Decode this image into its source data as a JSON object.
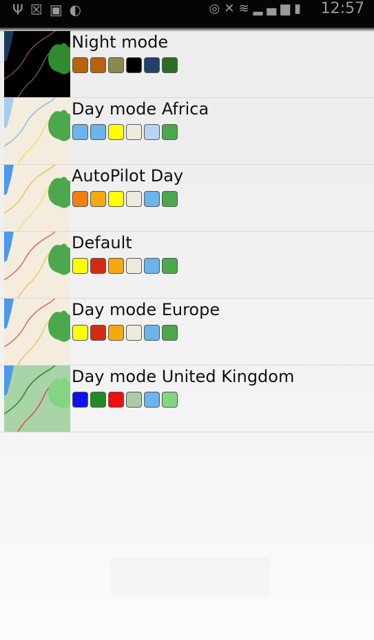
{
  "status_bar": {
    "time": "12:57",
    "left_icons": [
      "usb-icon",
      "close-notification-icon",
      "image-icon",
      "alarm-icon"
    ],
    "right_icons": [
      "eye-icon",
      "mute-icon",
      "wifi-icon",
      "signal-icon",
      "battery-icon"
    ]
  },
  "themes": [
    {
      "name": "Night mode",
      "thumb": {
        "bg": "#000000",
        "water": "#1a3a5c",
        "road1": "#7a4a1a",
        "road2": "#5a5a3a",
        "park": "#2e8b2e"
      },
      "colors": [
        "#b8620c",
        "#b8620c",
        "#8a8a50",
        "#000000",
        "#22416a",
        "#2c6b26"
      ]
    },
    {
      "name": "Day mode Africa",
      "thumb": {
        "bg": "#f4ecdd",
        "water": "#a8ccf0",
        "road1": "#8dc2ea",
        "road2": "#f0e070",
        "park": "#4ca84c"
      },
      "colors": [
        "#6cb4ec",
        "#6cb4ec",
        "#ffff00",
        "#f0eadd",
        "#b8d4f4",
        "#4ca84c"
      ]
    },
    {
      "name": "AutoPilot Day",
      "thumb": {
        "bg": "#f4ecdd",
        "water": "#4a9aec",
        "road1": "#f0c070",
        "road2": "#f4e090",
        "park": "#4ca84c"
      },
      "colors": [
        "#f08010",
        "#f6a810",
        "#ffff00",
        "#f0eadd",
        "#6cb4ec",
        "#4ca84c"
      ]
    },
    {
      "name": "Default",
      "thumb": {
        "bg": "#f4ecdd",
        "water": "#4a9aec",
        "road1": "#e0705a",
        "road2": "#f0c870",
        "park": "#4ca84c"
      },
      "colors": [
        "#ffff00",
        "#d42a10",
        "#f6a810",
        "#f0eadd",
        "#6cb4ec",
        "#4ca84c"
      ]
    },
    {
      "name": "Day mode Europe",
      "thumb": {
        "bg": "#f4ecdd",
        "water": "#4a9aec",
        "road1": "#e0705a",
        "road2": "#f0c870",
        "park": "#4ca84c"
      },
      "colors": [
        "#ffff00",
        "#d42a10",
        "#f6a810",
        "#f0eadd",
        "#6cb4ec",
        "#4ca84c"
      ]
    },
    {
      "name": "Day mode United Kingdom",
      "thumb": {
        "bg": "#a8d4a8",
        "water": "#4a9aec",
        "road1": "#2e8b2e",
        "road2": "#e0505a",
        "park": "#84d484"
      },
      "colors": [
        "#1010ee",
        "#248a24",
        "#ee1010",
        "#a8cca8",
        "#6cb4ec",
        "#84d484"
      ]
    }
  ]
}
